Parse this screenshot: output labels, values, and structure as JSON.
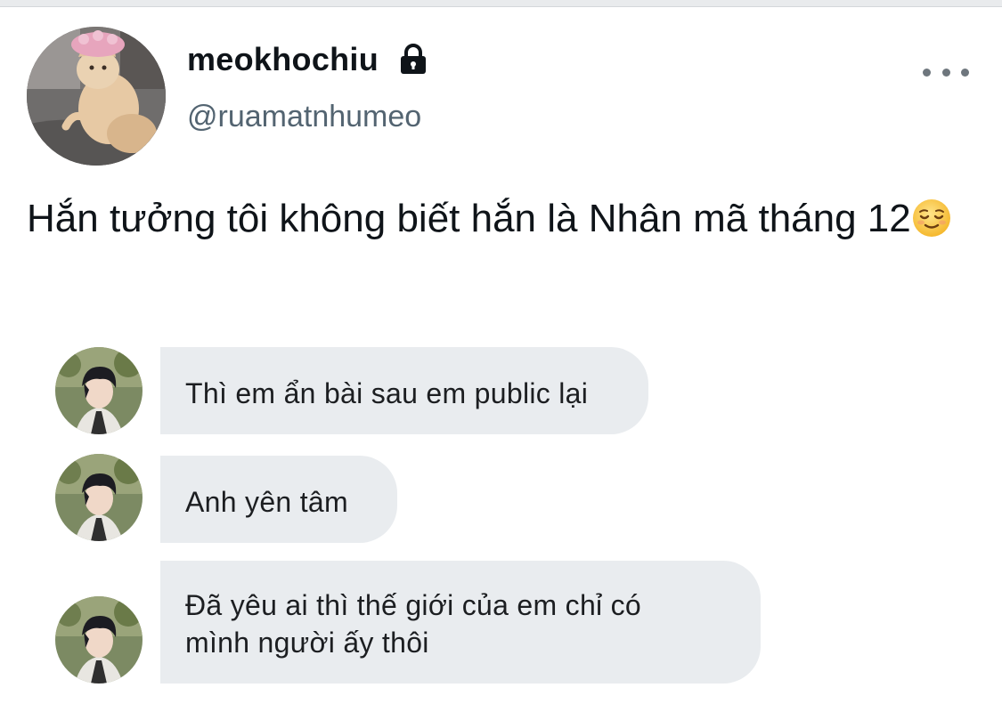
{
  "profile": {
    "display_name": "meokhochiu",
    "handle": "@ruamatnhumeo",
    "avatar_icon": "cat-with-shower-cap-avatar",
    "locked_icon": "lock-icon"
  },
  "tweet": {
    "text": "Hắn tưởng tôi không biết hắn là Nhân mã tháng 12",
    "emoji": "relieved-face-emoji"
  },
  "messages": [
    {
      "text": "Thì em ẩn bài sau em public lại"
    },
    {
      "text": "Anh yên tâm"
    },
    {
      "text_line1": "Đã yêu ai thì thế giới của em chỉ có",
      "text_line2": "mình người ấy thôi"
    }
  ],
  "colors": {
    "bubble": "#e9ecef",
    "handle": "#536471",
    "text": "#0f1419"
  }
}
